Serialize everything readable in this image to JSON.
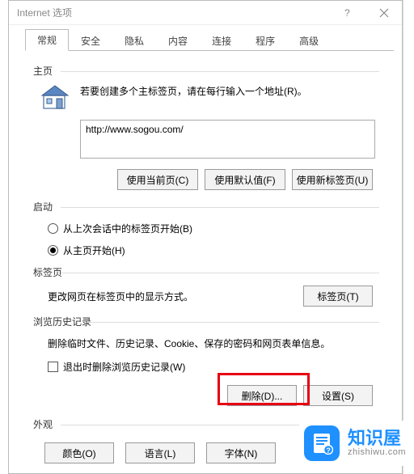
{
  "window": {
    "title": "Internet 选项"
  },
  "tabs": [
    "常规",
    "安全",
    "隐私",
    "内容",
    "连接",
    "程序",
    "高级"
  ],
  "homepage": {
    "section": "主页",
    "instruction": "若要创建多个主标签页，请在每行输入一个地址(R)。",
    "url": "http://www.sogou.com/",
    "btn_current": "使用当前页(C)",
    "btn_default": "使用默认值(F)",
    "btn_newtab": "使用新标签页(U)"
  },
  "startup": {
    "section": "启动",
    "opt_last": "从上次会话中的标签页开始(B)",
    "opt_home": "从主页开始(H)"
  },
  "tabpage": {
    "section": "标签页",
    "desc": "更改网页在标签页中的显示方式。",
    "btn": "标签页(T)"
  },
  "history": {
    "section": "浏览历史记录",
    "desc": "删除临时文件、历史记录、Cookie、保存的密码和网页表单信息。",
    "chk_exit": "退出时删除浏览历史记录(W)",
    "btn_delete": "删除(D)...",
    "btn_settings": "设置(S)"
  },
  "appearance": {
    "section": "外观",
    "btn_color": "颜色(O)",
    "btn_lang": "语言(L)",
    "btn_font": "字体(N)"
  },
  "watermark": {
    "name": "知识屋",
    "domain": "zhishiwu.com"
  }
}
